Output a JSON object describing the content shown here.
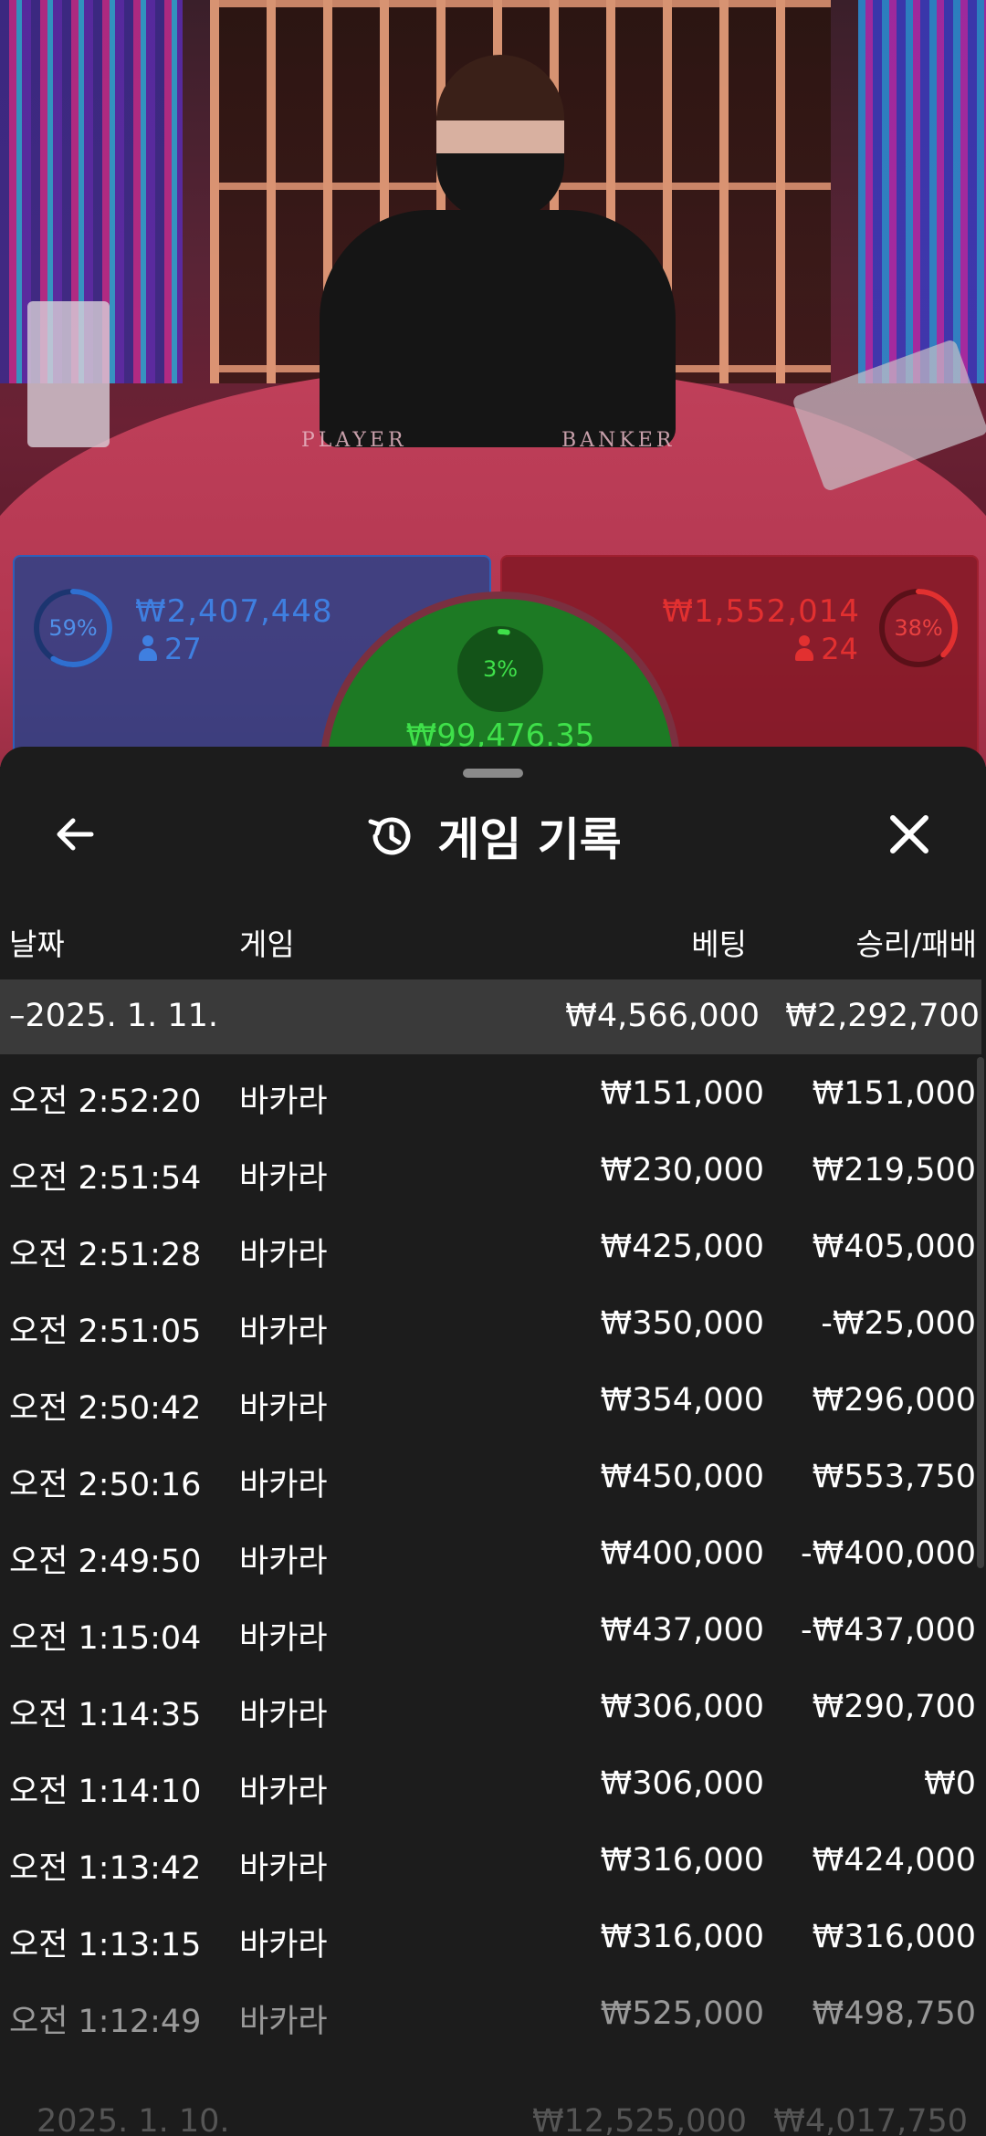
{
  "stage": {
    "table_labels": {
      "player": "PLAYER",
      "banker": "BANKER"
    },
    "player": {
      "percent": "59%",
      "percent_value": 59,
      "amount": "₩2,407,448",
      "players": "27",
      "color": "#2f6fd0"
    },
    "banker": {
      "percent": "38%",
      "percent_value": 38,
      "amount": "₩1,552,014",
      "players": "24",
      "color": "#e23030"
    },
    "tie": {
      "percent": "3%",
      "percent_value": 3,
      "amount": "₩99,476.35",
      "color": "#3fe04a"
    }
  },
  "sheet": {
    "title": "게임 기록",
    "icons": {
      "back": "back-arrow-icon",
      "history": "history-icon",
      "close": "close-icon"
    },
    "columns": {
      "date": "날짜",
      "game": "게임",
      "bet": "베팅",
      "win_loss": "승리/패배"
    },
    "date_group": {
      "date": "–2025. 1. 11.",
      "bet": "₩4,566,000",
      "win_loss": "₩2,292,700"
    },
    "rows": [
      {
        "time": "오전 2:52:20",
        "game": "바카라",
        "bet": "₩151,000",
        "win_loss": "₩151,000"
      },
      {
        "time": "오전 2:51:54",
        "game": "바카라",
        "bet": "₩230,000",
        "win_loss": "₩219,500"
      },
      {
        "time": "오전 2:51:28",
        "game": "바카라",
        "bet": "₩425,000",
        "win_loss": "₩405,000"
      },
      {
        "time": "오전 2:51:05",
        "game": "바카라",
        "bet": "₩350,000",
        "win_loss": "-₩25,000"
      },
      {
        "time": "오전 2:50:42",
        "game": "바카라",
        "bet": "₩354,000",
        "win_loss": "₩296,000"
      },
      {
        "time": "오전 2:50:16",
        "game": "바카라",
        "bet": "₩450,000",
        "win_loss": "₩553,750"
      },
      {
        "time": "오전 2:49:50",
        "game": "바카라",
        "bet": "₩400,000",
        "win_loss": "-₩400,000"
      },
      {
        "time": "오전 1:15:04",
        "game": "바카라",
        "bet": "₩437,000",
        "win_loss": "-₩437,000"
      },
      {
        "time": "오전 1:14:35",
        "game": "바카라",
        "bet": "₩306,000",
        "win_loss": "₩290,700"
      },
      {
        "time": "오전 1:14:10",
        "game": "바카라",
        "bet": "₩306,000",
        "win_loss": "₩0"
      },
      {
        "time": "오전 1:13:42",
        "game": "바카라",
        "bet": "₩316,000",
        "win_loss": "₩424,000"
      },
      {
        "time": "오전 1:13:15",
        "game": "바카라",
        "bet": "₩316,000",
        "win_loss": "₩316,000"
      },
      {
        "time": "오전 1:12:49",
        "game": "바카라",
        "bet": "₩525,000",
        "win_loss": "₩498,750"
      }
    ],
    "next_date_group": {
      "date": "2025. 1. 10.",
      "bet": "₩12,525,000",
      "win_loss": "₩4,017,750"
    }
  }
}
